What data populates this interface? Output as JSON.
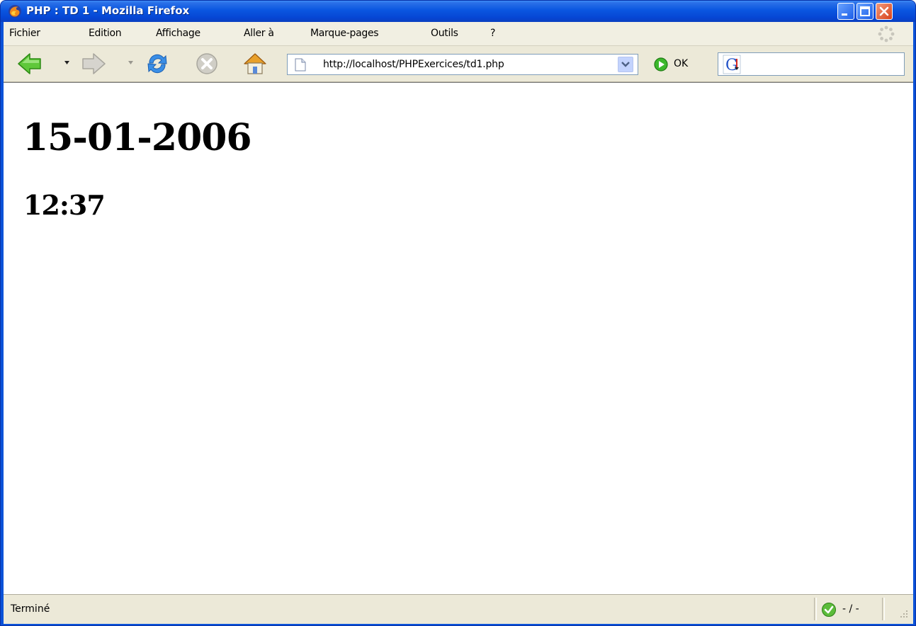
{
  "window": {
    "title": "PHP : TD 1 - Mozilla Firefox"
  },
  "menubar": {
    "items": [
      {
        "label": "Fichier",
        "name": "menu-fichier"
      },
      {
        "label": "Edition",
        "name": "menu-edition"
      },
      {
        "label": "Affichage",
        "name": "menu-affichage"
      },
      {
        "label": "Aller à",
        "name": "menu-aller-a"
      },
      {
        "label": "Marque-pages",
        "name": "menu-marque-pages"
      },
      {
        "label": "Outils",
        "name": "menu-outils"
      },
      {
        "label": "?",
        "name": "menu-help"
      }
    ]
  },
  "toolbar": {
    "url": "http://localhost/PHPExercices/td1.php",
    "go_label": "OK"
  },
  "page": {
    "date": "15-01-2006",
    "time": "12:37"
  },
  "statusbar": {
    "text": "Terminé",
    "extra": "- / -"
  },
  "colors": {
    "titlebar": "#0a56e0",
    "chrome": "#ece9d8",
    "close_button": "#d8421a"
  },
  "icons": [
    "firefox-icon",
    "throbber-icon",
    "back-icon",
    "forward-icon",
    "reload-icon",
    "stop-icon",
    "home-icon",
    "page-icon",
    "go-icon",
    "google-icon",
    "check-icon",
    "resize-grip-icon"
  ]
}
